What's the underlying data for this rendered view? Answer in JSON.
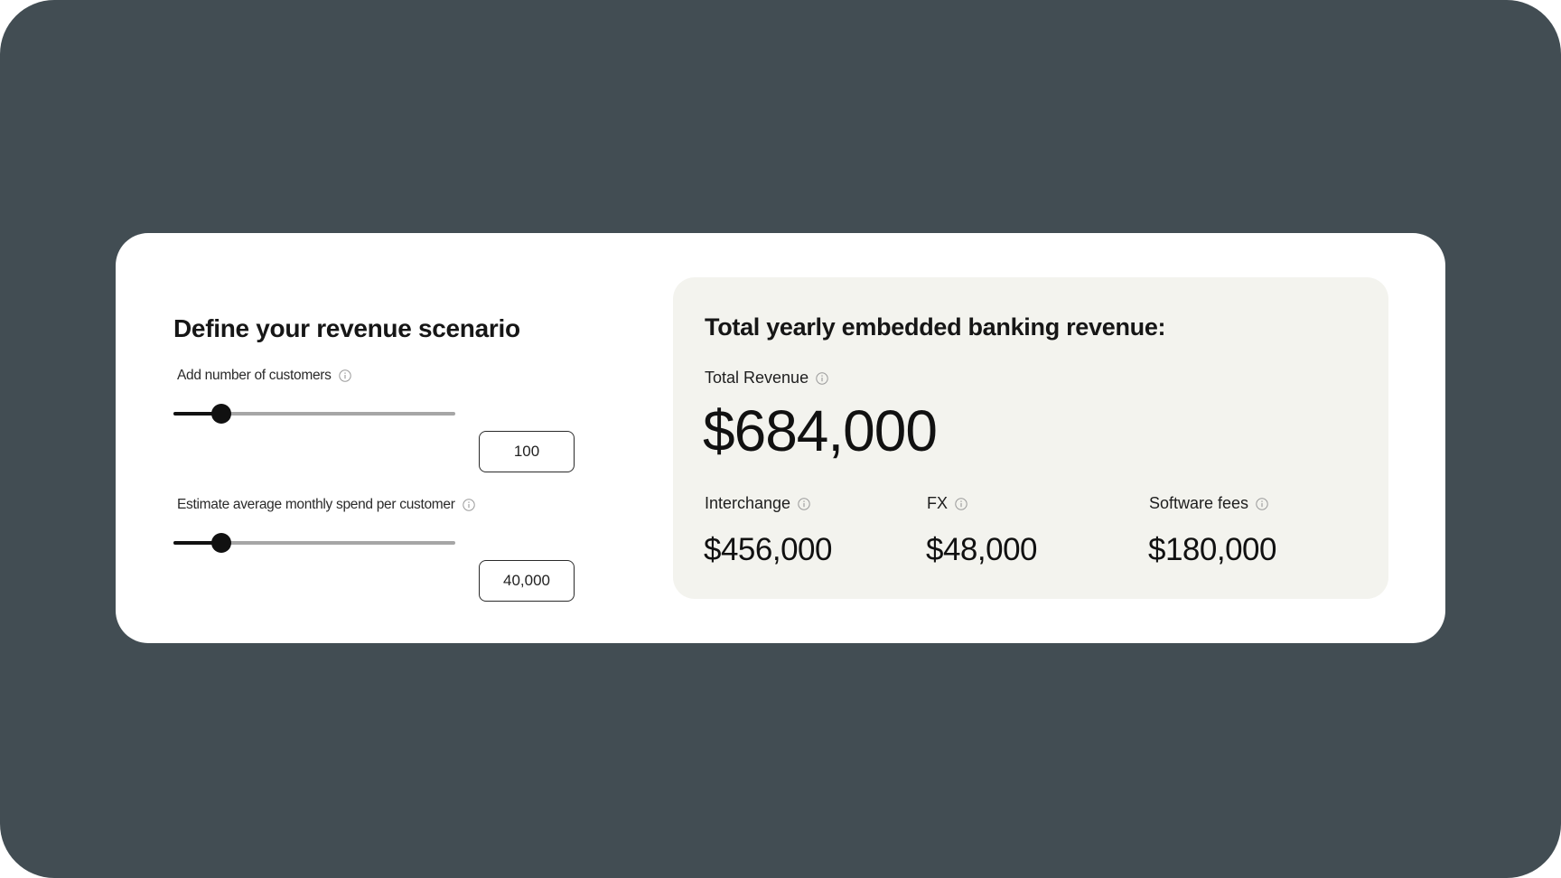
{
  "scenario": {
    "title": "Define your revenue scenario",
    "customers": {
      "label": "Add number of customers",
      "value": "100",
      "slider_fraction": 0.17
    },
    "spend": {
      "label": "Estimate average monthly spend per customer",
      "value": "40,000",
      "slider_fraction": 0.17
    }
  },
  "results": {
    "title": "Total yearly embedded banking revenue:",
    "total": {
      "label": "Total Revenue",
      "value": "$684,000"
    },
    "breakdown": [
      {
        "label": "Interchange",
        "value": "$456,000"
      },
      {
        "label": "FX",
        "value": "$48,000"
      },
      {
        "label": "Software fees",
        "value": "$180,000"
      }
    ]
  },
  "colors": {
    "background": "#424d53",
    "card": "#ffffff",
    "panel": "#f3f3ee",
    "accent": "#111111",
    "track": "#a6a6a6"
  },
  "icons": {
    "info": "info-icon"
  }
}
